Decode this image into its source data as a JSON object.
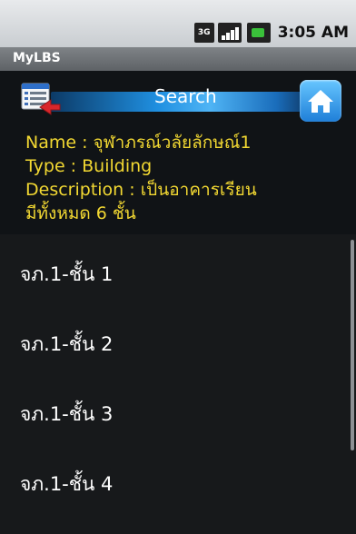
{
  "status_bar": {
    "network": "3G",
    "time": "3:05 AM"
  },
  "app": {
    "title": "MyLBS"
  },
  "search": {
    "label": "Search"
  },
  "info": {
    "name": "Name : จุฬาภรณ์วลัยลักษณ์1",
    "type": "Type : Building",
    "description_line1": "Description : เป็นอาคารเรียน",
    "description_line2": "มีทั้งหมด 6 ชั้น"
  },
  "list": {
    "items": [
      {
        "label": "จภ.1-ชั้น 1"
      },
      {
        "label": "จภ.1-ชั้น 2"
      },
      {
        "label": "จภ.1-ชั้น 3"
      },
      {
        "label": "จภ.1-ชั้น 4"
      }
    ]
  },
  "colors": {
    "info_text": "#f2d832",
    "list_background": "#17191b",
    "search_strip": "#1f8fe0"
  },
  "icons": {
    "list_button": "list-back-icon",
    "home_button": "home-icon"
  }
}
